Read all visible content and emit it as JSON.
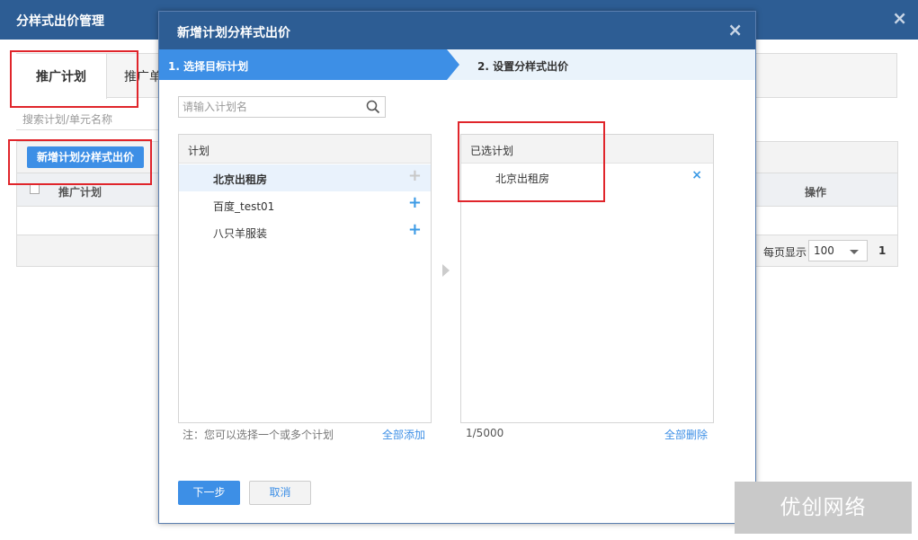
{
  "outer": {
    "title": "分样式出价管理",
    "close": "×",
    "tabs": [
      {
        "label": "推广计划"
      },
      {
        "label": "推广单"
      }
    ],
    "search_placeholder": "搜索计划/单元名称",
    "new_button": "新增计划分样式出价",
    "table": {
      "headers": [
        "推广计划",
        "操作"
      ]
    },
    "pager": {
      "per_page_label": "每页显示",
      "per_page_value": "100",
      "page": "1"
    }
  },
  "modal": {
    "title": "新增计划分样式出价",
    "close": "×",
    "steps": [
      "1. 选择目标计划",
      "2. 设置分样式出价"
    ],
    "search_placeholder": "请输入计划名",
    "left_panel": {
      "header": "计划",
      "items": [
        {
          "name": "北京出租房",
          "selected": true
        },
        {
          "name": "百度_test01",
          "selected": false
        },
        {
          "name": "八只羊服装",
          "selected": false
        }
      ]
    },
    "right_panel": {
      "header": "已选计划",
      "items": [
        {
          "name": "北京出租房"
        }
      ]
    },
    "note": "注：您可以选择一个或多个计划",
    "add_all": "全部添加",
    "count": "1/5000",
    "delete_all": "全部删除",
    "next_button": "下一步",
    "cancel_button": "取消"
  },
  "colors": {
    "header_blue": "#2d5d94",
    "accent_blue": "#3d8fe6",
    "highlight_red": "#e0252b"
  },
  "watermark": "优创网络"
}
